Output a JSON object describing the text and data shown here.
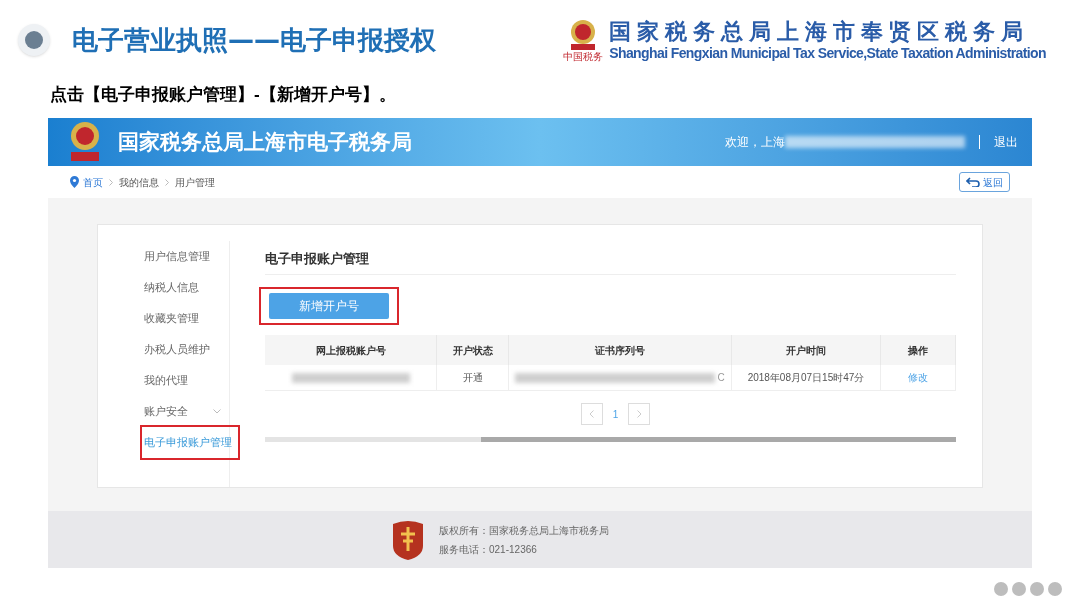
{
  "slide": {
    "title": "电子营业执照——电子申报授权",
    "org_name_cn": "国家税务总局上海市奉贤区税务局",
    "org_name_en": "Shanghai Fengxian Municipal Tax Service,State Taxation Administration",
    "logo_caption": "中国税务",
    "instruction": "点击【电子申报账户管理】-【新增开户号】。"
  },
  "site": {
    "banner_title": "国家税务总局上海市电子税务局",
    "welcome": "欢迎，上海",
    "logout": "退出",
    "breadcrumb": [
      {
        "label": "首页"
      },
      {
        "label": "我的信息"
      },
      {
        "label": "用户管理"
      }
    ],
    "back_button": "返回",
    "sidebar": [
      {
        "label": "用户信息管理",
        "selected": false,
        "expandable": false,
        "highlighted": false
      },
      {
        "label": "纳税人信息",
        "selected": false,
        "expandable": false,
        "highlighted": false
      },
      {
        "label": "收藏夹管理",
        "selected": false,
        "expandable": false,
        "highlighted": false
      },
      {
        "label": "办税人员维护",
        "selected": false,
        "expandable": false,
        "highlighted": false
      },
      {
        "label": "我的代理",
        "selected": false,
        "expandable": false,
        "highlighted": false
      },
      {
        "label": "账户安全",
        "selected": false,
        "expandable": true,
        "highlighted": false
      },
      {
        "label": "电子申报账户管理",
        "selected": true,
        "expandable": false,
        "highlighted": true
      }
    ],
    "section_title": "电子申报账户管理",
    "add_button": {
      "label": "新增开户号",
      "highlighted": true
    },
    "table": {
      "columns": [
        "网上报税账户号",
        "开户状态",
        "证书序列号",
        "开户时间",
        "操作"
      ],
      "rows": [
        {
          "cells": [
            {
              "kind": "redacted"
            },
            {
              "kind": "text",
              "text": "开通"
            },
            {
              "kind": "redacted",
              "text": "C"
            },
            {
              "kind": "text",
              "text": "2018年08月07日15时47分"
            },
            {
              "kind": "link",
              "text": "修改"
            }
          ]
        }
      ]
    },
    "pagination": {
      "pages": [
        {
          "label": "1",
          "selected": true
        }
      ]
    },
    "footer": {
      "copyright": "版权所有：国家税务总局上海市税务局",
      "phone": "服务电话：021-12366"
    }
  }
}
